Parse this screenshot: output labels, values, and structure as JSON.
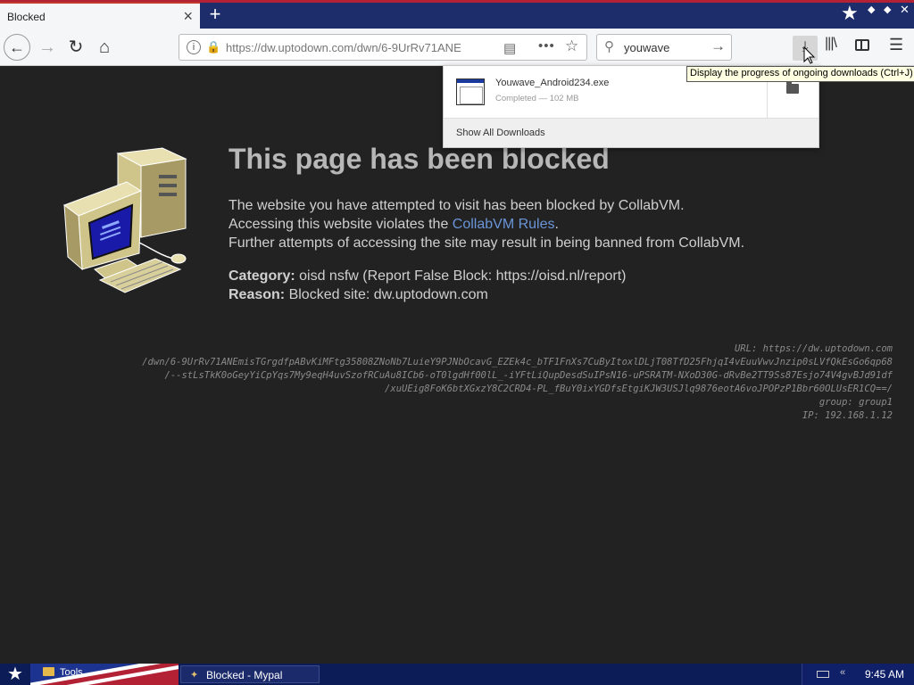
{
  "browser": {
    "tab_title": "Blocked",
    "tab_close": "×",
    "new_tab": "+",
    "url": "https://dw.uptodown.com/dwn/6-9UrRv71ANE",
    "search_value": "youwave",
    "tooltip": "Display the progress of ongoing downloads (Ctrl+J)"
  },
  "downloads": {
    "file_name": "Youwave_Android234.exe",
    "file_status": "Completed — 102 MB",
    "show_all": "Show All Downloads"
  },
  "page": {
    "heading": "This page has been blocked",
    "line1": "The website you have attempted to visit has been blocked by CollabVM.",
    "line2_prefix": "Accessing this website violates the ",
    "line2_link": "CollabVM Rules",
    "line2_suffix": ".",
    "line3": "Further attempts of accessing the site may result in being banned from CollabVM.",
    "category_label": "Category:",
    "category_value": " oisd nsfw (Report False Block: https://oisd.nl/report)",
    "reason_label": "Reason:",
    "reason_value": " Blocked site: dw.uptodown.com"
  },
  "details": {
    "url_line1": "URL: https://dw.uptodown.com",
    "url_line2": "/dwn/6-9UrRv71ANEmisTGrgdfpABvKiMFtg35808ZNoNb7LuieY9PJNbOcavG_EZEk4c_bTF1FnXs7CuByItoxlDLjT08TfD25FhjqI4vEuuVwvJnzip0sLVfQkEsGo6qp68",
    "url_line3": "/--stLsTkK0oGeyYiCpYqs7My9eqH4uvSzofRCuAu8ICb6-oT0lgdHf00lL_-iYFtLiQupDesdSuIPsN16-uPSRATM-NXoD30G-dRvBe2TT9Ss87Esjo74V4gvBJd91df",
    "url_line4": "/xuUEig8FoK6btXGxzY8C2CRD4-PL_fBuY0ixYGDfsEtgiKJW3USJlq9876eotA6voJPOPzP1Bbr60OLUsER1CQ==/",
    "group": "group: group1",
    "ip": "IP: 192.168.1.12"
  },
  "taskbar": {
    "tools": "Tools",
    "task_label": "Blocked - Mypal",
    "clock": "9:45 AM"
  }
}
